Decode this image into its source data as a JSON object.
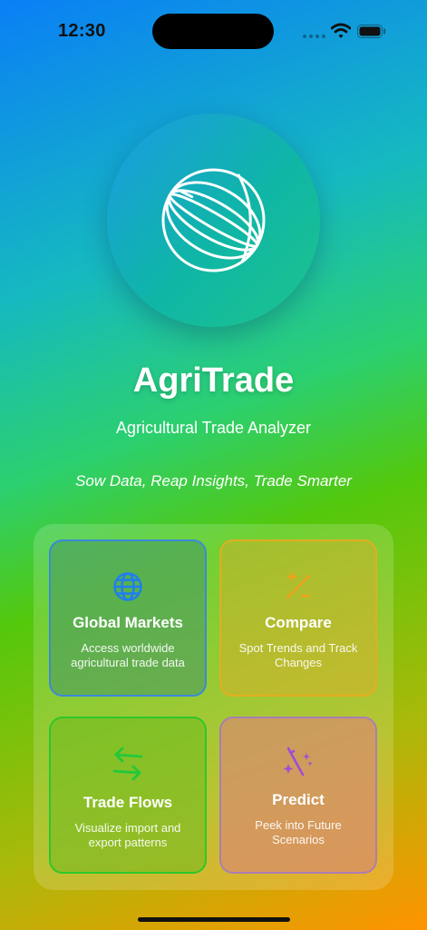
{
  "status_bar": {
    "time": "12:30"
  },
  "app": {
    "title": "AgriTrade",
    "subtitle": "Agricultural Trade Analyzer",
    "tagline": "Sow Data, Reap Insights, Trade Smarter"
  },
  "logo": {
    "icon": "globe-icon"
  },
  "features": [
    {
      "title": "Global Markets",
      "description": "Access worldwide agricultural trade data",
      "icon": "globe-icon",
      "icon_color": "#1f7ef0",
      "border_color": "#3b8ad8"
    },
    {
      "title": "Compare",
      "description": "Spot Trends and Track Changes",
      "icon": "compare-slash-icon",
      "icon_color": "#f0a21a",
      "border_color": "#f0aa1e"
    },
    {
      "title": "Trade Flows",
      "description": "Visualize import and export patterns",
      "icon": "arrows-exchange-icon",
      "icon_color": "#22c93a",
      "border_color": "#2ec72a"
    },
    {
      "title": "Predict",
      "description": "Peek into Future Scenarios",
      "icon": "magic-wand-icon",
      "icon_color": "#a24bd8",
      "border_color": "#a078c8"
    }
  ],
  "colors": {
    "gradient_top": "#0a7ff6",
    "gradient_middle": "#54c80c",
    "gradient_bottom": "#ff9300"
  }
}
